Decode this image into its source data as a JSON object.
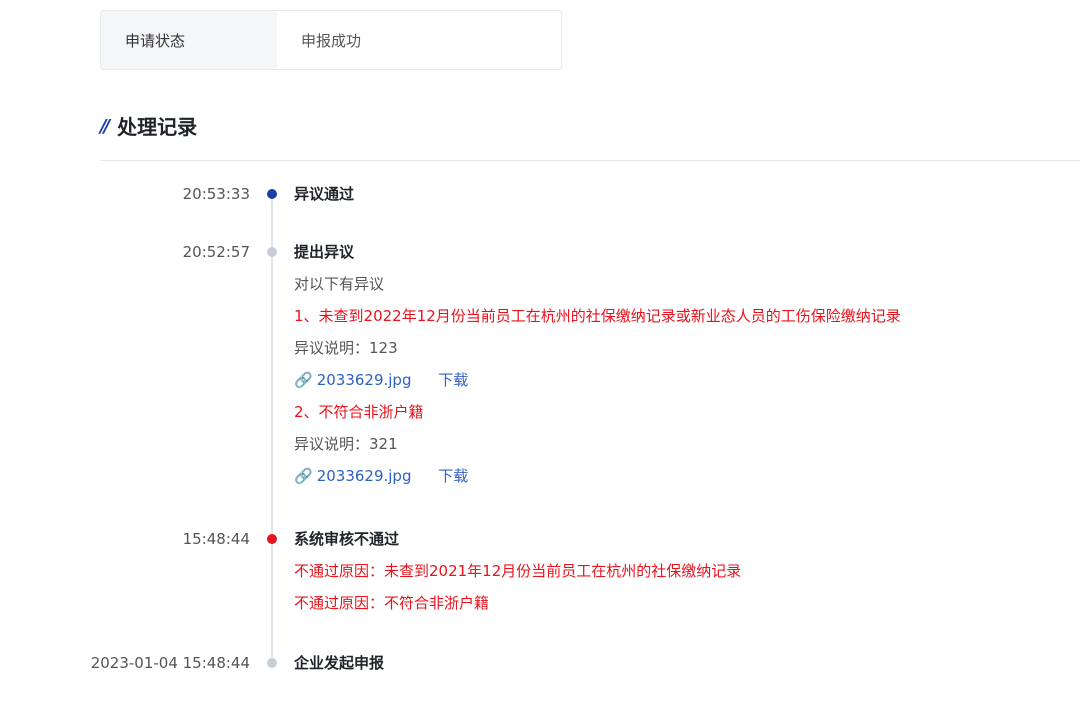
{
  "status": {
    "label": "申请状态",
    "value": "申报成功"
  },
  "section": {
    "title": "处理记录",
    "icon": "double-slash-icon"
  },
  "colors": {
    "accent": "#1a3fa8",
    "error": "#e8131d",
    "link": "#2f5fc4",
    "dot_gray": "#c8ced8"
  },
  "records": [
    {
      "time": "20:53:33",
      "title": "异议通过",
      "dot": "blue"
    },
    {
      "time": "20:52:57",
      "title": "提出异议",
      "dot": "gray",
      "intro": "对以下有异议",
      "items": [
        {
          "reason": "1、未查到2022年12月份当前员工在杭州的社保缴纳记录或新业态人员的工伤保险缴纳记录",
          "note": "异议说明：123",
          "file": "2033629.jpg",
          "download": "下载"
        },
        {
          "reason": "2、不符合非浙户籍",
          "note": "异议说明：321",
          "file": "2033629.jpg",
          "download": "下载"
        }
      ]
    },
    {
      "time": "15:48:44",
      "title": "系统审核不通过",
      "dot": "red",
      "reasons": [
        "不通过原因：未查到2021年12月份当前员工在杭州的社保缴纳记录",
        "不通过原因：不符合非浙户籍"
      ]
    },
    {
      "time": "2023-01-04 15:48:44",
      "title": "企业发起申报",
      "dot": "gray"
    }
  ]
}
